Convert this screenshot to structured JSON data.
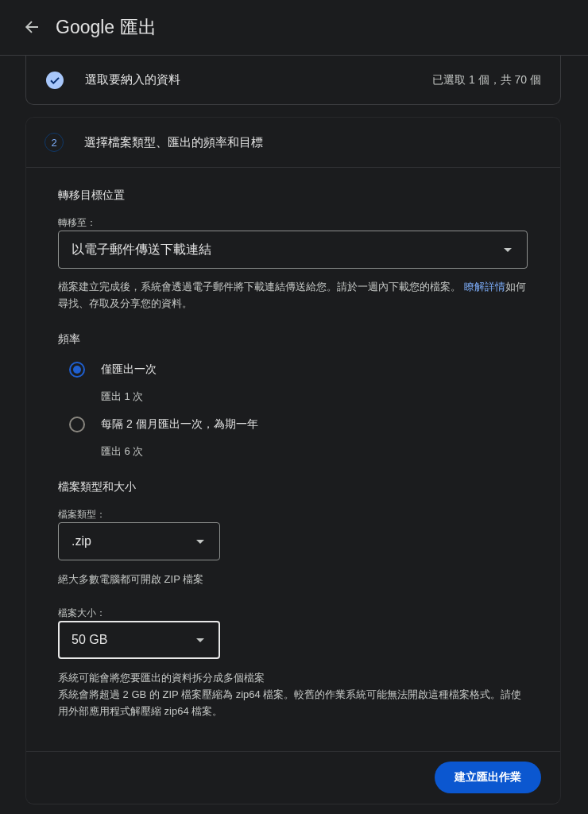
{
  "header": {
    "title": "Google 匯出"
  },
  "steps": [
    {
      "kind": "completed",
      "title": "選取要納入的資料",
      "summary": "已選取 1 個，共 70 個"
    },
    {
      "kind": "current",
      "number": "2",
      "title": "選擇檔案類型、匯出的頻率和目標"
    }
  ],
  "destination": {
    "heading": "轉移目標位置",
    "field_label": "轉移至：",
    "value": "以電子郵件傳送下載連結",
    "focused": false,
    "help": "檔案建立完成後，系統會透過電子郵件將下載連結傳送給您。請於一週內下載您的檔案。",
    "link": "瞭解詳情",
    "help_after": "如何尋找、存取及分享您的資料。"
  },
  "frequency": {
    "heading": "頻率",
    "options": [
      {
        "label": "僅匯出一次",
        "detail": "匯出 1 次",
        "selected": true
      },
      {
        "label": "每隔 2 個月匯出一次，為期一年",
        "detail": "匯出 6 次",
        "selected": false
      }
    ]
  },
  "file": {
    "heading": "檔案類型和大小",
    "type": {
      "label": "檔案類型：",
      "value": ".zip",
      "focused": false
    },
    "type_note": "絕大多數電腦都可開啟 ZIP 檔案",
    "size": {
      "label": "檔案大小：",
      "value": "50 GB",
      "focused": true
    },
    "notes": [
      "系統可能會將您要匯出的資料拆分成多個檔案",
      "系統會將超過 2 GB 的 ZIP 檔案壓縮為 zip64 檔案。較舊的作業系統可能無法開啟這種檔案格式。請使用外部應用程式解壓縮 zip64 檔案。"
    ]
  },
  "action": {
    "label": "建立匯出作業"
  }
}
